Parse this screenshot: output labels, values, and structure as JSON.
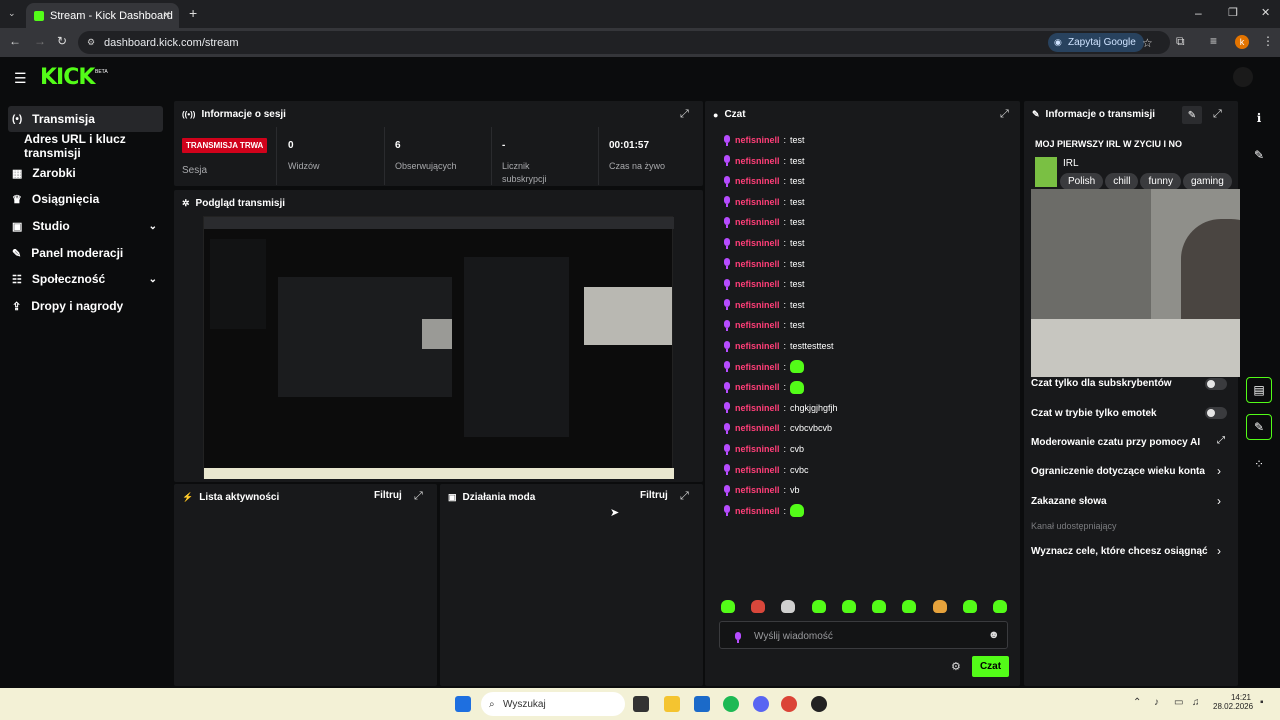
{
  "browser": {
    "tab_title": "Stream - Kick Dashboard",
    "url": "dashboard.kick.com/stream",
    "google_btn": "Zapytaj Google",
    "profile_initial": "k"
  },
  "brand": {
    "logo": "KICK",
    "beta": "BETA",
    "accent": "#53fc18"
  },
  "sidebar": {
    "items": [
      {
        "label": "Transmisja",
        "icon": "broadcast-icon"
      },
      {
        "label": "Adres URL i klucz transmisji",
        "icon": ""
      },
      {
        "label": "Zarobki",
        "icon": "earnings-icon"
      },
      {
        "label": "Osiągnięcia",
        "icon": "trophy-icon"
      },
      {
        "label": "Studio",
        "icon": "studio-icon"
      },
      {
        "label": "Panel moderacji",
        "icon": "wrench-icon"
      },
      {
        "label": "Społeczność",
        "icon": "community-icon"
      },
      {
        "label": "Dropy i nagrody",
        "icon": "drops-icon"
      }
    ]
  },
  "session": {
    "title": "Informacje o sesji",
    "live_badge": "TRANSMISJA TRWA",
    "live_label": "Sesja",
    "stats": [
      {
        "value": "0",
        "label": "Widzów"
      },
      {
        "value": "6",
        "label": "Obserwujących"
      },
      {
        "value": "-",
        "label": "Licznik subskrypcji"
      },
      {
        "value": "00:01:57",
        "label": "Czas na żywo"
      }
    ]
  },
  "preview": {
    "title": "Podgląd transmisji"
  },
  "activity": {
    "title": "Lista aktywności",
    "filter": "Filtruj"
  },
  "mod": {
    "title": "Działania moda",
    "filter": "Filtruj"
  },
  "chat": {
    "title": "Czat",
    "username": "nefisninell",
    "messages": [
      {
        "text": "test",
        "emote": false
      },
      {
        "text": "test",
        "emote": false
      },
      {
        "text": "test",
        "emote": false
      },
      {
        "text": "test",
        "emote": false
      },
      {
        "text": "test",
        "emote": false
      },
      {
        "text": "test",
        "emote": false
      },
      {
        "text": "test",
        "emote": false
      },
      {
        "text": "test",
        "emote": false
      },
      {
        "text": "test",
        "emote": false
      },
      {
        "text": "test",
        "emote": false
      },
      {
        "text": "testtesttest",
        "emote": false
      },
      {
        "text": "",
        "emote": true
      },
      {
        "text": "",
        "emote": true
      },
      {
        "text": "chgkjgjhgfjh",
        "emote": false
      },
      {
        "text": "cvbcvbcvb",
        "emote": false
      },
      {
        "text": "cvb",
        "emote": false
      },
      {
        "text": "cvbc",
        "emote": false
      },
      {
        "text": "vb",
        "emote": false
      },
      {
        "text": "",
        "emote": true
      }
    ],
    "placeholder": "Wyślij wiadomość",
    "send": "Czat"
  },
  "stream_info": {
    "title": "Informacje o transmisji",
    "stream_title": "MOJ PIERWSZY IRL W ZYCIU I NO",
    "category": "IRL",
    "tags": [
      "Polish",
      "chill",
      "funny",
      "gaming"
    ]
  },
  "settings": {
    "sub_only": "Czat tylko dla subskrybentów",
    "emote_only": "Czat w trybie tylko emotek",
    "ai_mod": "Moderowanie czatu przy pomocy AI",
    "age_limit": "Ograniczenie dotyczące wieku konta",
    "banned_words": "Zakazane słowa",
    "shared_channel": "Kanał udostępniający",
    "goals": "Wyznacz cele, które chcesz osiągnąć"
  },
  "taskbar": {
    "search": "Wyszukaj",
    "time": "14:21",
    "date": "28.02.2026"
  }
}
